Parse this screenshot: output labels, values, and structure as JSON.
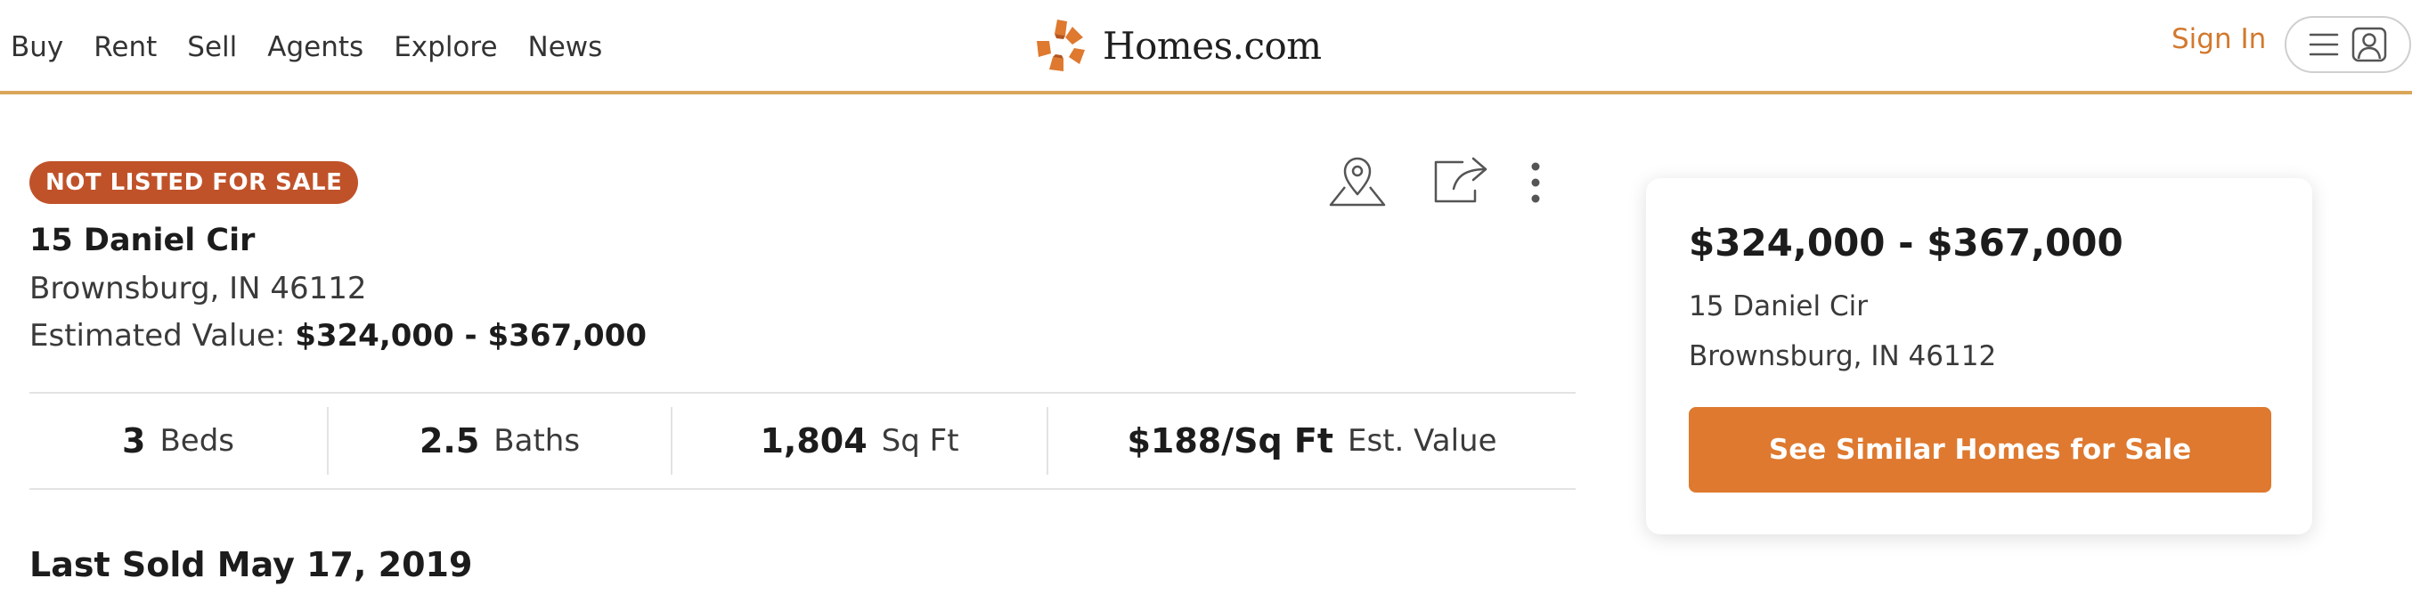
{
  "header": {
    "nav": [
      "Buy",
      "Rent",
      "Sell",
      "Agents",
      "Explore",
      "News"
    ],
    "logo_text": "Homes.com",
    "sign_in": "Sign In",
    "brand_color": "#de792f",
    "icons": {
      "logo": "homes-star-logo",
      "menu": "hamburger-menu-icon",
      "account": "user-account-icon"
    }
  },
  "listing": {
    "status_badge": "NOT LISTED FOR SALE",
    "status_color": "#c0522a",
    "street": "15 Daniel Cir",
    "city_state_zip": "Brownsburg, IN 46112",
    "estimated_label": "Estimated Value:",
    "estimated_value": "$324,000 - $367,000",
    "actions": [
      "map-pin-icon",
      "share-icon",
      "more-options-icon"
    ]
  },
  "stats": [
    {
      "value": "3",
      "label": "Beds"
    },
    {
      "value": "2.5",
      "label": "Baths"
    },
    {
      "value": "1,804",
      "label": "Sq Ft"
    },
    {
      "value": "$188/Sq Ft",
      "label": "Est. Value"
    }
  ],
  "last_sold": "Last Sold May 17, 2019",
  "card": {
    "price": "$324,000 - $367,000",
    "street": "15 Daniel Cir",
    "city_state_zip": "Brownsburg, IN 46112",
    "button": "See Similar Homes for Sale"
  }
}
